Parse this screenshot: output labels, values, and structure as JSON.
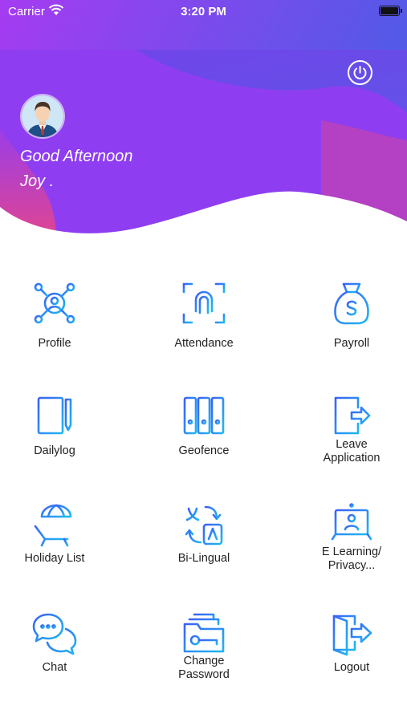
{
  "status_bar": {
    "carrier": "Carrier",
    "time": "3:20 PM"
  },
  "header": {
    "greeting": "Good Afternoon",
    "user_name": "Joy ."
  },
  "colors": {
    "gradient_start": "#a63bf2",
    "gradient_end": "#4f5be6",
    "wave_pink": "#e2458f",
    "icon_start": "#3b62f5",
    "icon_end": "#1fb7f2"
  },
  "menu": {
    "profile": "Profile",
    "attendance": "Attendance",
    "payroll": "Payroll",
    "dailylog": "Dailylog",
    "geofence": "Geofence",
    "leave_line1": "Leave",
    "leave_line2": "Application",
    "holiday": "Holiday List",
    "bilingual": "Bi-Lingual",
    "elearning_line1": "E Learning/",
    "elearning_line2": "Privacy...",
    "chat": "Chat",
    "change_pw_line1": "Change",
    "change_pw_line2": "Password",
    "logout": "Logout"
  }
}
